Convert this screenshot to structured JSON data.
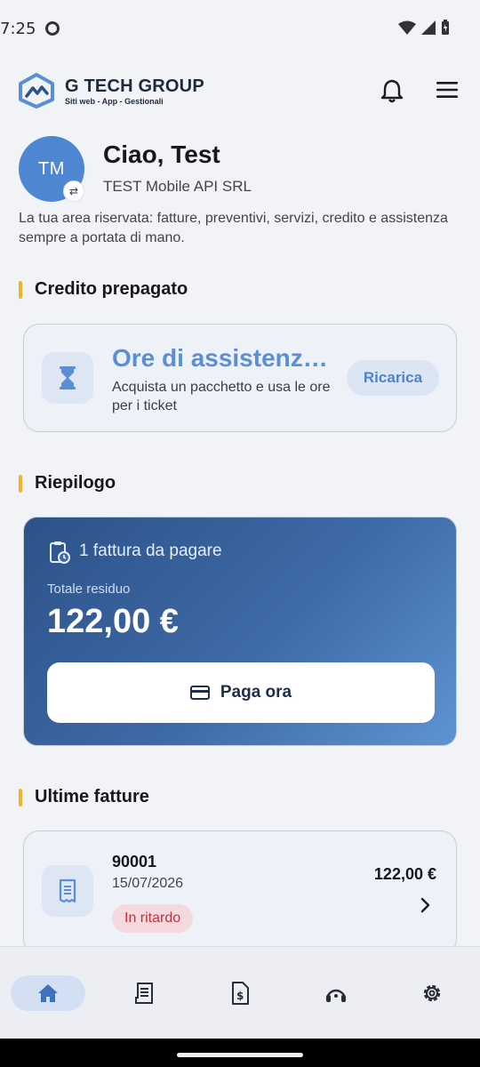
{
  "status_bar": {
    "time": "7:25"
  },
  "header": {
    "brand_name": "G TECH GROUP",
    "brand_tagline": "Siti web - App - Gestionali"
  },
  "profile": {
    "initials": "TM",
    "greeting": "Ciao, Test",
    "company": "TEST Mobile API SRL",
    "intro": "La tua area riservata: fatture, preventivi, servizi, credito e assistenza sempre a portata di mano."
  },
  "credit": {
    "section_title": "Credito prepagato",
    "title": "Ore di assistenza prepagate",
    "description": "Acquista un pacchetto e usa le ore per i ticket",
    "recharge_label": "Ricarica"
  },
  "summary": {
    "section_title": "Riepilogo",
    "unpaid_count": "1 fattura da pagare",
    "total_label": "Totale residuo",
    "total_amount": "122,00 €",
    "pay_label": "Paga ora"
  },
  "invoices": {
    "section_title": "Ultime fatture",
    "items": [
      {
        "number": "90001",
        "date": "15/07/2026",
        "status": "In ritardo",
        "amount": "122,00 €"
      }
    ]
  },
  "bottom_nav": {
    "items": [
      "home-icon",
      "invoices-icon",
      "quotes-icon",
      "support-icon",
      "settings-icon"
    ],
    "active": "home-icon"
  },
  "colors": {
    "accent": "#4f86d2",
    "section_bar": "#f0b429",
    "overdue": "#c2313f"
  }
}
